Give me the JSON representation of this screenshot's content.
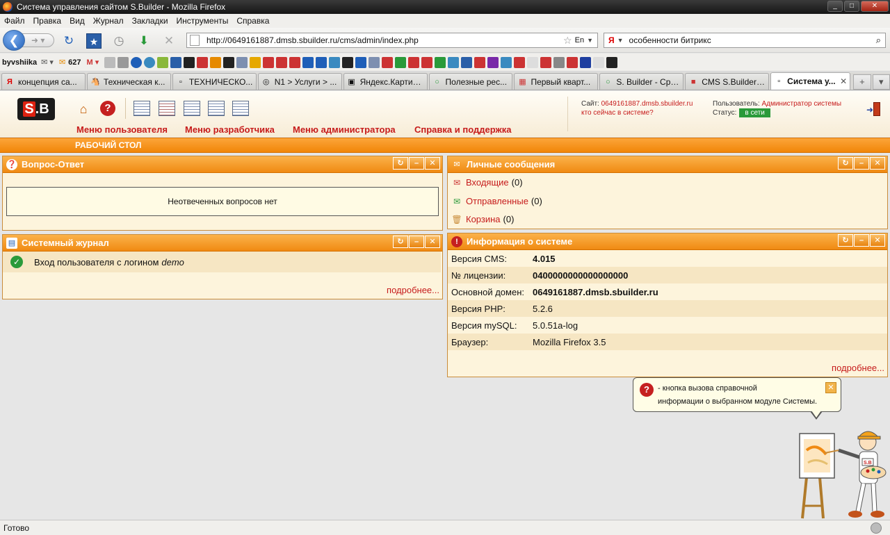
{
  "window": {
    "title": "Система управления сайтом S.Builder - Mozilla Firefox",
    "controls": [
      "_",
      "□",
      "✕"
    ]
  },
  "menubar": [
    "Файл",
    "Правка",
    "Вид",
    "Журнал",
    "Закладки",
    "Инструменты",
    "Справка"
  ],
  "navbar": {
    "url": "http://0649161887.dmsb.sbuilder.ru/cms/admin/index.php",
    "lang": "En",
    "search_engine": "Я",
    "search_query": "особенности битрикс"
  },
  "bookmarks": {
    "username": "byvshiika",
    "count": "627"
  },
  "tabs": [
    {
      "label": "концепция са...",
      "icon": "Я"
    },
    {
      "label": "Техническая к...",
      "icon": "🐴"
    },
    {
      "label": "ТЕХНИЧЕСКО...",
      "icon": "▫"
    },
    {
      "label": "N1 > Услуги > ...",
      "icon": "◎"
    },
    {
      "label": "Яндекс.Картин...",
      "icon": "▣"
    },
    {
      "label": "Полезные рес...",
      "icon": "○"
    },
    {
      "label": "Первый кварт...",
      "icon": "▦"
    },
    {
      "label": "S. Builder - Сра...",
      "icon": "○"
    },
    {
      "label": "CMS S.Builder: ...",
      "icon": "■"
    },
    {
      "label": "Система у...",
      "icon": "▫",
      "active": true
    }
  ],
  "cms": {
    "menu": [
      "Меню пользователя",
      "Меню разработчика",
      "Меню администратора",
      "Справка и поддержка"
    ],
    "site_label": "Сайт:",
    "site_value": "0649161887.dmsb.sbuilder.ru",
    "who_online": "кто сейчас в системе?",
    "user_label": "Пользователь:",
    "user_value": "Администратор системы",
    "status_label": "Статус:",
    "status_value": "в сети",
    "desktop_tab": "РАБОЧИЙ СТОЛ"
  },
  "panels": {
    "qa": {
      "title": "Вопрос-Ответ",
      "message": "Неотвеченных вопросов нет"
    },
    "messages": {
      "title": "Личные сообщения",
      "rows": [
        {
          "label": "Входящие",
          "count": "(0)"
        },
        {
          "label": "Отправленные",
          "count": "(0)"
        },
        {
          "label": "Корзина",
          "count": "(0)"
        }
      ]
    },
    "syslog": {
      "title": "Системный журнал",
      "entry_text": "Вход пользователя с логином ",
      "entry_login": "demo",
      "more": "подробнее..."
    },
    "sysinfo": {
      "title": "Информация о системе",
      "rows": [
        {
          "key": "Версия CMS:",
          "value": "4.015"
        },
        {
          "key": "№ лицензии:",
          "value": "0400000000000000000"
        },
        {
          "key": "Основной домен:",
          "value": "0649161887.dmsb.sbuilder.ru"
        },
        {
          "key": "Версия PHP:",
          "value": "5.2.6"
        },
        {
          "key": "Версия mySQL:",
          "value": "5.0.51a-log"
        },
        {
          "key": "Браузер:",
          "value": "Mozilla Firefox 3.5"
        }
      ],
      "more": "подробнее..."
    }
  },
  "tooltip": {
    "line1": "- кнопка вызова справочной",
    "line2": "информации о выбранном модуле Системы."
  },
  "statusbar": {
    "text": "Готово"
  },
  "colors": {
    "accent_orange": "#f18608",
    "link_red": "#c61b1b",
    "online_green": "#2a9a3a"
  }
}
